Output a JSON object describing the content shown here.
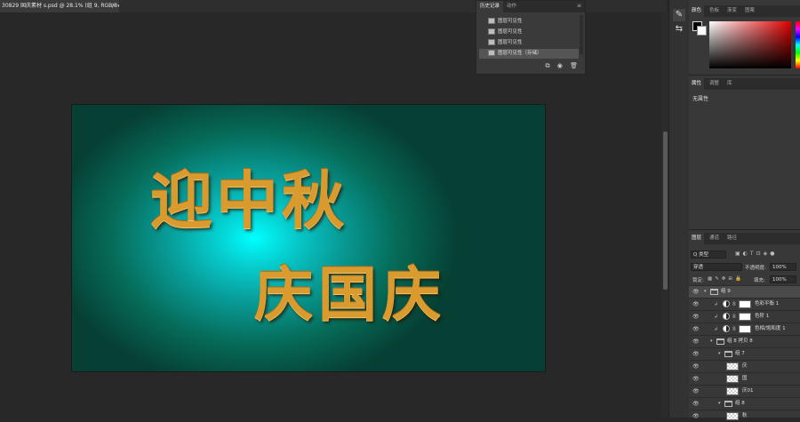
{
  "document": {
    "tab_title": "30829 国庆素材 s.psd @ 28.1% (组 9, RGB/8#) *",
    "close_glyph": "×",
    "art_line1": "迎中秋",
    "art_line2": "庆国庆"
  },
  "history_panel": {
    "tabs": [
      "历史记录",
      "动作"
    ],
    "menu_glyph": "≡",
    "items": [
      "图层可见性",
      "图层可见性",
      "图层可见性",
      "图层可见性（存储）"
    ],
    "footer_icons": [
      "new-snapshot-icon",
      "camera-icon",
      "trash-icon"
    ],
    "footer_glyphs": [
      "⧉",
      "◉",
      "🗑"
    ]
  },
  "tools": {
    "glyphs": [
      "✎",
      "⇆"
    ]
  },
  "color_panel": {
    "tabs": [
      "颜色",
      "色板",
      "渐变",
      "图案"
    ],
    "foreground": "#000000",
    "background": "#ffffff"
  },
  "properties_panel": {
    "tabs": [
      "属性",
      "调整",
      "库"
    ],
    "empty_text": "无属性"
  },
  "layers_panel": {
    "tabs": [
      "图层",
      "通道",
      "路径"
    ],
    "filter_label": "Q 类型",
    "blend_mode": "穿透",
    "opacity_label": "不透明度:",
    "opacity_value": "100%",
    "lock_label": "锁定:",
    "fill_label": "填充:",
    "fill_value": "100%",
    "layers": [
      {
        "name": "组 9",
        "kind": "group",
        "indent": 0,
        "selected": true
      },
      {
        "name": "色彩平衡 1",
        "kind": "adjustment",
        "indent": 1
      },
      {
        "name": "色阶 1",
        "kind": "adjustment",
        "indent": 1
      },
      {
        "name": "色相/饱和度 1",
        "kind": "adjustment",
        "indent": 1
      },
      {
        "name": "组 8 拷贝 8",
        "kind": "group",
        "indent": 1
      },
      {
        "name": "组 7",
        "kind": "group",
        "indent": 2
      },
      {
        "name": "庆",
        "kind": "pixel",
        "indent": 3
      },
      {
        "name": "国",
        "kind": "pixel",
        "indent": 3
      },
      {
        "name": "庆01",
        "kind": "pixel",
        "indent": 3
      },
      {
        "name": "组 8",
        "kind": "group",
        "indent": 2
      },
      {
        "name": "秋",
        "kind": "pixel",
        "indent": 3
      }
    ]
  }
}
